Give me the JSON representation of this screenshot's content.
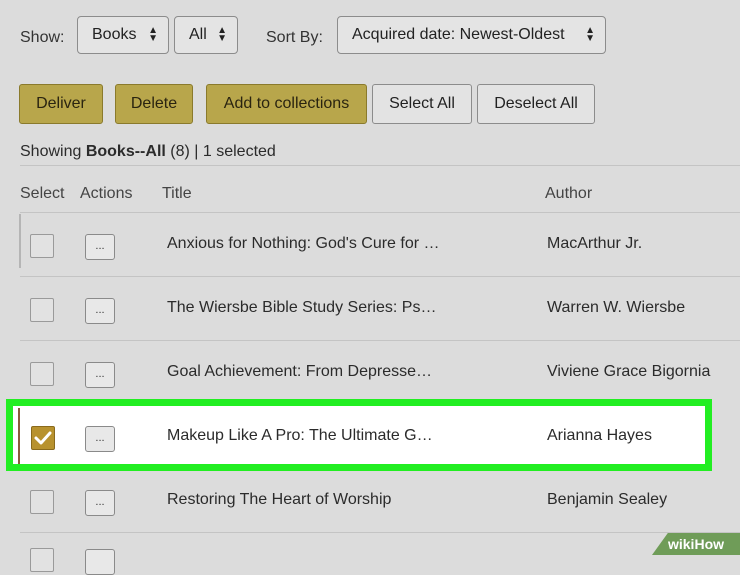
{
  "filters": {
    "show_label": "Show:",
    "type_value": "Books",
    "scope_value": "All",
    "sort_label": "Sort By:",
    "sort_value": "Acquired date: Newest-Oldest"
  },
  "toolbar": {
    "deliver": "Deliver",
    "delete": "Delete",
    "add_to_collections": "Add to collections",
    "select_all": "Select All",
    "deselect_all": "Deselect All"
  },
  "status": {
    "prefix": "Showing ",
    "bold": "Books--All",
    "suffix": " (8) | 1 selected"
  },
  "columns": {
    "select": "Select",
    "actions": "Actions",
    "title": "Title",
    "author": "Author"
  },
  "rows": [
    {
      "title": "Anxious for Nothing: God's Cure for …",
      "author": "MacArthur Jr.",
      "checked": false
    },
    {
      "title": "The Wiersbe Bible Study Series: Ps…",
      "author": "Warren W. Wiersbe",
      "checked": false
    },
    {
      "title": "Goal Achievement: From Depresse…",
      "author": "Viviene Grace Bigornia",
      "checked": false
    },
    {
      "title": "Makeup Like A Pro: The Ultimate G…",
      "author": "Arianna Hayes",
      "checked": true
    },
    {
      "title": "Restoring The Heart of Worship",
      "author": "Benjamin Sealey",
      "checked": false
    }
  ],
  "row_action_label": "...",
  "colors": {
    "accent_gold": "#b8a64b",
    "highlight_green": "#22ee22",
    "checkbox_checked": "#b8922e"
  },
  "watermark": {
    "wiki": "wiki",
    "how": "How"
  }
}
